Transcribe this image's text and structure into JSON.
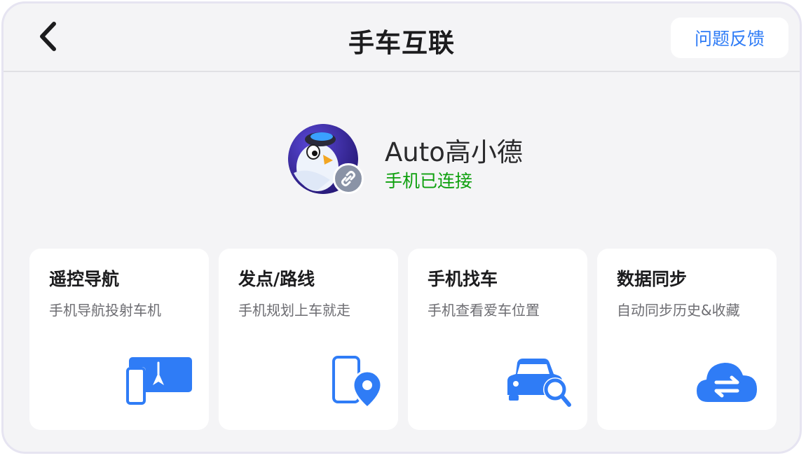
{
  "header": {
    "title": "手车互联",
    "feedback_label": "问题反馈"
  },
  "profile": {
    "name": "Auto高小德",
    "status": "手机已连接"
  },
  "cards": [
    {
      "title": "遥控导航",
      "desc": "手机导航投射车机",
      "icon": "phone-cast-navigation-icon"
    },
    {
      "title": "发点/路线",
      "desc": "手机规划上车就走",
      "icon": "phone-location-pin-icon"
    },
    {
      "title": "手机找车",
      "desc": "手机查看爱车位置",
      "icon": "car-search-icon"
    },
    {
      "title": "数据同步",
      "desc": "自动同步历史&收藏",
      "icon": "cloud-sync-icon"
    }
  ],
  "colors": {
    "accent": "#2f7cf6",
    "status_connected": "#0ea00e",
    "panel_bg": "#f4f4f6",
    "card_bg": "#ffffff"
  }
}
